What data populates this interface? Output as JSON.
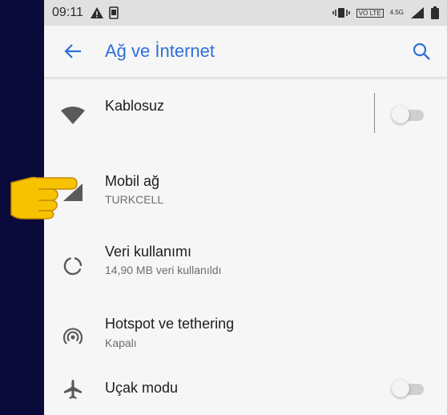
{
  "status_bar": {
    "time": "09:11",
    "volte_label": "VO LTE",
    "network_type": "4.5G"
  },
  "app_bar": {
    "title": "Ağ ve İnternet",
    "back_icon": "arrow-back-icon",
    "search_icon": "search-icon"
  },
  "settings": [
    {
      "title": "Kablosuz",
      "subtitle": "",
      "icon": "wifi-icon",
      "toggle": false
    },
    {
      "title": "Mobil ağ",
      "subtitle": "TURKCELL",
      "icon": "signal-icon"
    },
    {
      "title": "Veri kullanımı",
      "subtitle": "14,90 MB veri kullanıldı",
      "icon": "data-usage-icon"
    },
    {
      "title": "Hotspot ve tethering",
      "subtitle": "Kapalı",
      "icon": "hotspot-icon"
    },
    {
      "title": "Uçak modu",
      "subtitle": "",
      "icon": "airplane-icon",
      "toggle": false
    }
  ],
  "colors": {
    "accent": "#2f6fd8",
    "backdrop": "#0b0b3b",
    "pointer": "#f7c300"
  }
}
